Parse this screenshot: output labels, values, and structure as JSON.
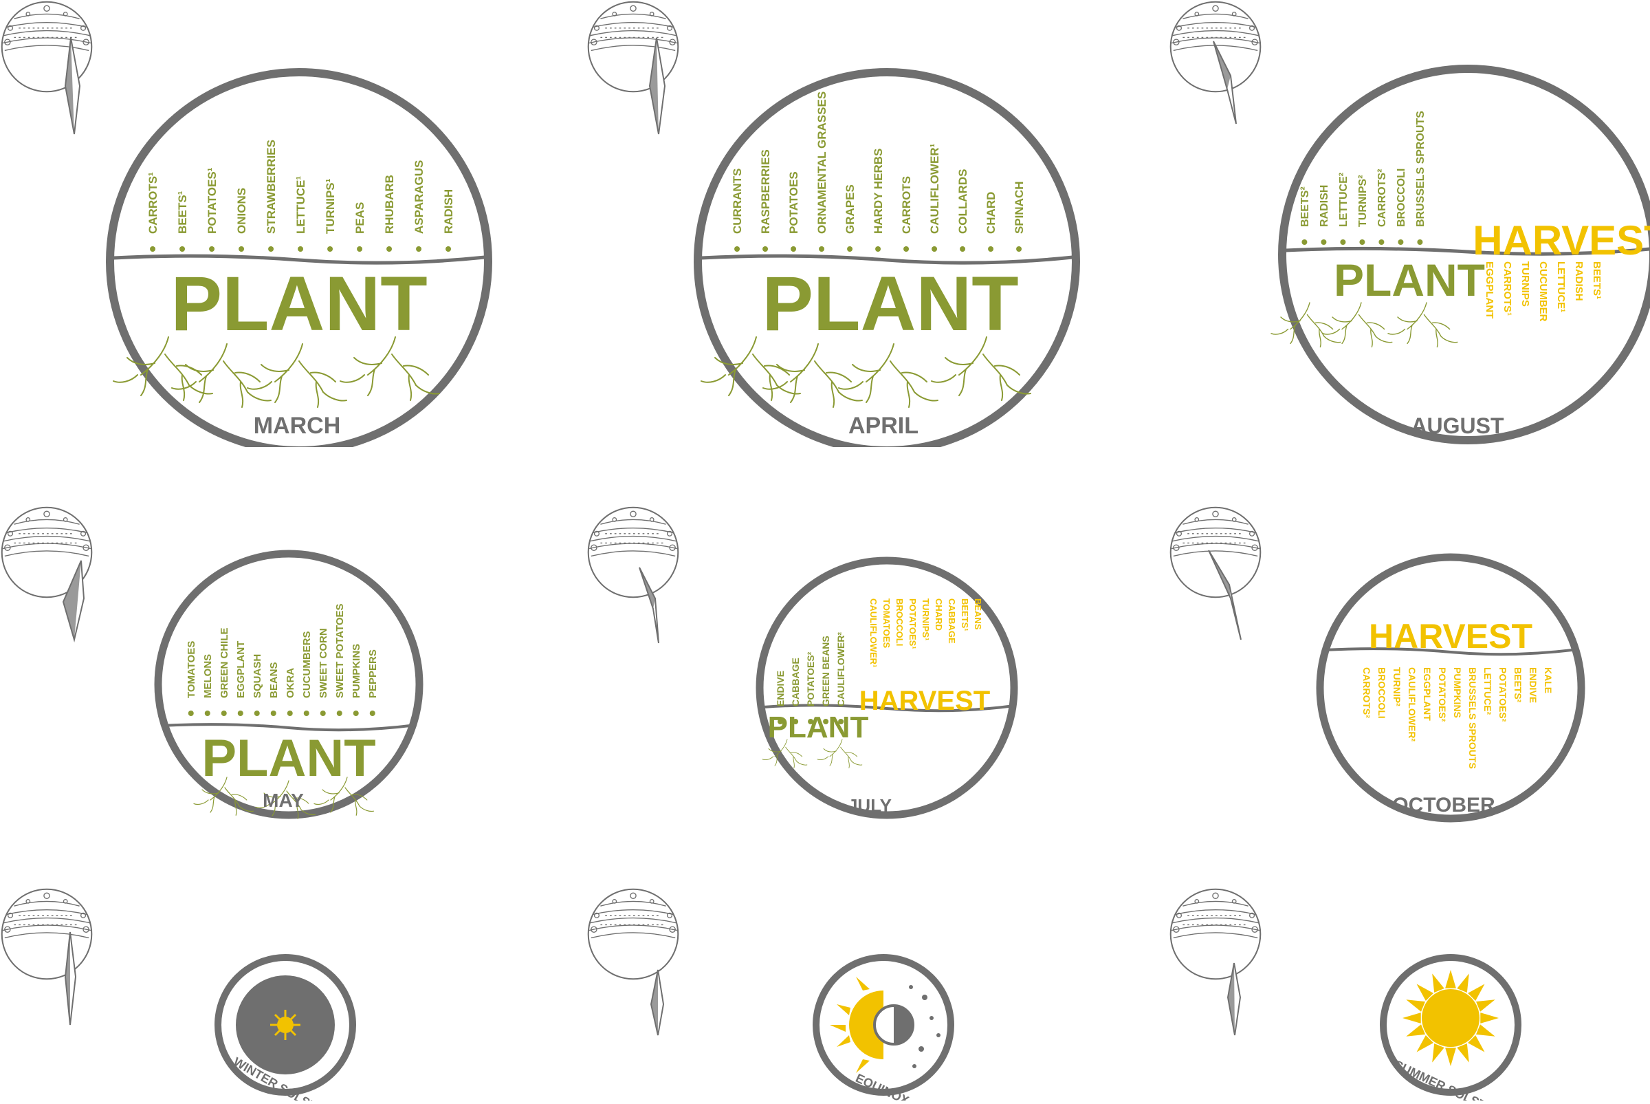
{
  "colors": {
    "plant": "#8a9a33",
    "harvest": "#f2c200",
    "ring": "#6f6f6f",
    "dark_sun_bg": "#6f6f6f"
  },
  "months": [
    {
      "name": "MARCH",
      "big_word": "PLANT",
      "plant_items": [
        "Carrots¹",
        "Beets¹",
        "Potatoes¹",
        "Onions",
        "Strawberries",
        "Lettuce¹",
        "Turnips¹",
        "Peas",
        "Rhubarb",
        "Asparagus",
        "Radish"
      ]
    },
    {
      "name": "APRIL",
      "big_word": "PLANT",
      "plant_items": [
        "Currants",
        "Raspberries",
        "Potatoes",
        "Ornamental Grasses",
        "Grapes",
        "Hardy Herbs",
        "Carrots",
        "Cauliflower¹",
        "Collards",
        "Chard",
        "Spinach"
      ]
    },
    {
      "name": "AUGUST",
      "big_word": "PLANT",
      "harvest_word": "HARVEST",
      "plant_items": [
        "Beets²",
        "Radish",
        "Lettuce²",
        "Turnips²",
        "Carrots²",
        "Broccoli",
        "Brussels Sprouts"
      ],
      "harvest_items": [
        "Eggplant",
        "Carrots¹",
        "Turnips",
        "Cucumber",
        "Lettuce¹",
        "Radish",
        "Beets¹"
      ]
    },
    {
      "name": "MAY",
      "big_word": "PLANT",
      "plant_items": [
        "Tomatoes",
        "Melons",
        "Green Chile",
        "Eggplant",
        "Squash",
        "Beans",
        "Okra",
        "Cucumbers",
        "Sweet Corn",
        "Sweet Potatoes",
        "Pumpkins",
        "Peppers"
      ]
    },
    {
      "name": "JULY",
      "big_word": "PLANT",
      "harvest_word": "HARVEST",
      "plant_items": [
        "Endive",
        "Cabbage",
        "Potatoes²",
        "Green Beans",
        "Cauliflower²"
      ],
      "harvest_items": [
        "Cauliflower¹",
        "Tomatoes",
        "Broccoli",
        "Potatoes¹",
        "Turnips¹",
        "Chard",
        "Cabbage",
        "Beets¹",
        "Beans"
      ]
    },
    {
      "name": "OCTOBER",
      "harvest_word": "HARVEST",
      "harvest_items": [
        "Carrots²",
        "Broccoli",
        "Turnip²",
        "Cauliflower²",
        "Eggplant",
        "Potatoes²",
        "Pumpkins",
        "Brussels Sprouts",
        "Lettuce²",
        "Potatoes²",
        "Beets²",
        "Endive",
        "Kale"
      ]
    }
  ],
  "seasons": [
    {
      "label": "WINTER SOLSTICE",
      "icon": "small-sun-icon"
    },
    {
      "label": "EQUINOX",
      "icon": "half-sun-half-moon-icon"
    },
    {
      "label": "SUMMER SOLSTICE",
      "icon": "large-sun-icon"
    }
  ]
}
